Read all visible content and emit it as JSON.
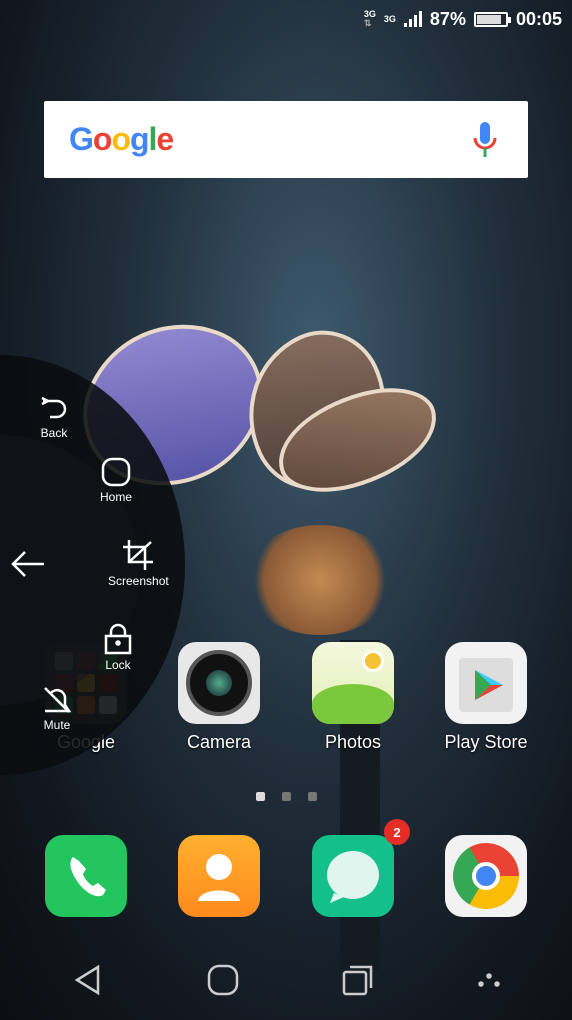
{
  "status_bar": {
    "network1": "3G",
    "network2": "3G",
    "battery": "87%",
    "battery_level": 87,
    "time": "00:05"
  },
  "search": {
    "logo": "Google",
    "mic_icon": "mic-icon"
  },
  "floating_dock": {
    "items": [
      {
        "label": "Back",
        "icon": "back-icon"
      },
      {
        "label": "Home",
        "icon": "home-icon"
      },
      {
        "label": "Screenshot",
        "icon": "crop-icon"
      },
      {
        "label": "Lock",
        "icon": "lock-icon"
      },
      {
        "label": "Mute",
        "icon": "bell-off-icon"
      }
    ],
    "collapse_icon": "arrow-left-icon"
  },
  "apps": [
    {
      "label": "Google"
    },
    {
      "label": "Camera"
    },
    {
      "label": "Photos"
    },
    {
      "label": "Play Store"
    }
  ],
  "page_indicator": {
    "pages": 3,
    "current": 1
  },
  "dock": [
    {
      "name": "Phone"
    },
    {
      "name": "Contacts"
    },
    {
      "name": "Messages",
      "badge": "2"
    },
    {
      "name": "Chrome"
    }
  ],
  "colors": {
    "google_blue": "#4285F4",
    "google_red": "#EA4335",
    "google_yellow": "#FBBC05",
    "google_green": "#34A853"
  }
}
